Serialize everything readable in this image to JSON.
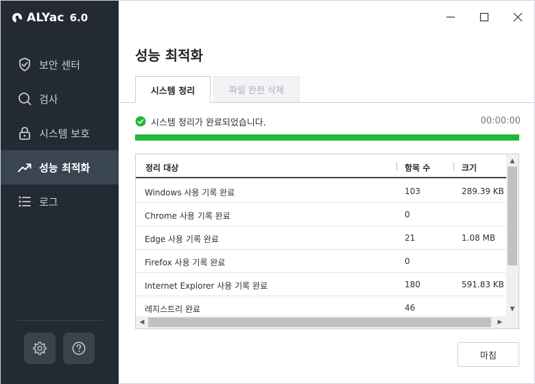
{
  "app": {
    "name": "ALYac",
    "version": "6.0"
  },
  "sidebar": {
    "items": [
      {
        "label": "보안 센터",
        "icon": "shield-icon",
        "active": false
      },
      {
        "label": "검사",
        "icon": "search-icon",
        "active": false
      },
      {
        "label": "시스템 보호",
        "icon": "lock-icon",
        "active": false
      },
      {
        "label": "성능 최적화",
        "icon": "trend-up-icon",
        "active": true
      },
      {
        "label": "로그",
        "icon": "list-icon",
        "active": false
      }
    ],
    "bottom_buttons": [
      {
        "name": "settings",
        "icon": "gear-icon"
      },
      {
        "name": "help",
        "icon": "question-icon"
      }
    ]
  },
  "window_controls": {
    "minimize_icon": "minimize-icon",
    "maximize_icon": "maximize-icon",
    "close_icon": "close-icon"
  },
  "main": {
    "title": "성능 최적화",
    "tabs": [
      {
        "label": "시스템 정리",
        "active": true
      },
      {
        "label": "파일 완전 삭제",
        "active": false
      }
    ],
    "status_text": "시스템 정리가 완료되었습니다.",
    "elapsed": "00:00:00",
    "progress": 1.0,
    "table": {
      "columns": [
        "정리 대상",
        "항목 수",
        "크기"
      ],
      "rows": [
        {
          "target": "Windows 사용 기록 완료",
          "count": "103",
          "size": "289.39 KB"
        },
        {
          "target": "Chrome 사용 기록 완료",
          "count": "0",
          "size": ""
        },
        {
          "target": "Edge 사용 기록 완료",
          "count": "21",
          "size": "1.08 MB"
        },
        {
          "target": "Firefox 사용 기록 완료",
          "count": "0",
          "size": ""
        },
        {
          "target": "Internet Explorer 사용 기록 완료",
          "count": "180",
          "size": "591.83 KB"
        },
        {
          "target": "레지스트리 완료",
          "count": "46",
          "size": ""
        }
      ]
    },
    "close_button": "마침"
  },
  "colors": {
    "sidebar_bg": "#232a33",
    "sidebar_active": "#3a4553",
    "progress_green": "#1fb83a",
    "check_green": "#1fb83a",
    "brand_icon": "#ffffff"
  }
}
